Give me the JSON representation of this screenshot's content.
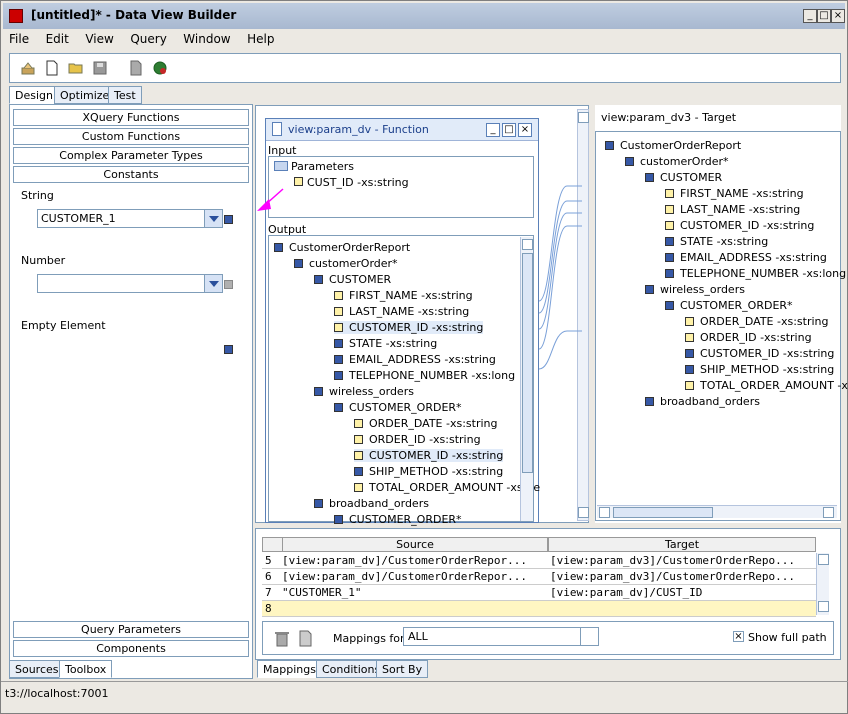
{
  "window": {
    "title": "[untitled]* - Data View Builder",
    "min": "_",
    "max": "□",
    "close": "×"
  },
  "menu": [
    "File",
    "Edit",
    "View",
    "Query",
    "Window",
    "Help"
  ],
  "top_tabs": [
    "Design",
    "Optimize",
    "Test"
  ],
  "left_panel": {
    "buttons_top": [
      "XQuery Functions",
      "Custom Functions",
      "Complex Parameter Types",
      "Constants"
    ],
    "string_label": "String",
    "string_value": "CUSTOMER_1",
    "number_label": "Number",
    "empty_label": "Empty Element",
    "buttons_bottom": [
      "Query Parameters",
      "Components"
    ],
    "bottom_tabs": [
      "Sources",
      "Toolbox"
    ]
  },
  "function_window": {
    "title": "view:param_dv - Function",
    "input_label": "Input",
    "output_label": "Output",
    "input_items": [
      "Parameters",
      "CUST_ID -xs:string"
    ],
    "output_items": [
      "CustomerOrderReport",
      "customerOrder*",
      "CUSTOMER",
      "FIRST_NAME -xs:string",
      "LAST_NAME -xs:string",
      "CUSTOMER_ID -xs:string",
      "STATE -xs:string",
      "EMAIL_ADDRESS -xs:string",
      "TELEPHONE_NUMBER -xs:long",
      "wireless_orders",
      "CUSTOMER_ORDER*",
      "ORDER_DATE -xs:string",
      "ORDER_ID -xs:string",
      "CUSTOMER_ID -xs:string",
      "SHIP_METHOD -xs:string",
      "TOTAL_ORDER_AMOUNT -xs:de",
      "broadband_orders",
      "CUSTOMER_ORDER*"
    ]
  },
  "target_panel": {
    "title": "view:param_dv3 - Target",
    "items": [
      "CustomerOrderReport",
      "customerOrder*",
      "CUSTOMER",
      "FIRST_NAME -xs:string",
      "LAST_NAME -xs:string",
      "CUSTOMER_ID -xs:string",
      "STATE -xs:string",
      "EMAIL_ADDRESS -xs:string",
      "TELEPHONE_NUMBER -xs:long",
      "wireless_orders",
      "CUSTOMER_ORDER*",
      "ORDER_DATE -xs:string",
      "ORDER_ID -xs:string",
      "CUSTOMER_ID -xs:string",
      "SHIP_METHOD -xs:string",
      "TOTAL_ORDER_AMOUNT -x",
      "broadband_orders"
    ]
  },
  "mappings": {
    "headers": [
      "Source",
      "Target"
    ],
    "rows": [
      {
        "n": "5",
        "source": "[view:param_dv]/CustomerOrderRepor...",
        "target": "[view:param_dv3]/CustomerOrderRepo..."
      },
      {
        "n": "6",
        "source": "[view:param_dv]/CustomerOrderRepor...",
        "target": "[view:param_dv3]/CustomerOrderRepo..."
      },
      {
        "n": "7",
        "source": "\"CUSTOMER_1\"",
        "target": "[view:param_dv]/CUST_ID"
      },
      {
        "n": "8",
        "source": "",
        "target": ""
      }
    ],
    "mappings_for_label": "Mappings for:",
    "mappings_for_value": "ALL",
    "show_full_path": "Show full path"
  },
  "bottom_tabs": [
    "Mappings",
    "Conditions",
    "Sort By"
  ],
  "status": "t3://localhost:7001"
}
